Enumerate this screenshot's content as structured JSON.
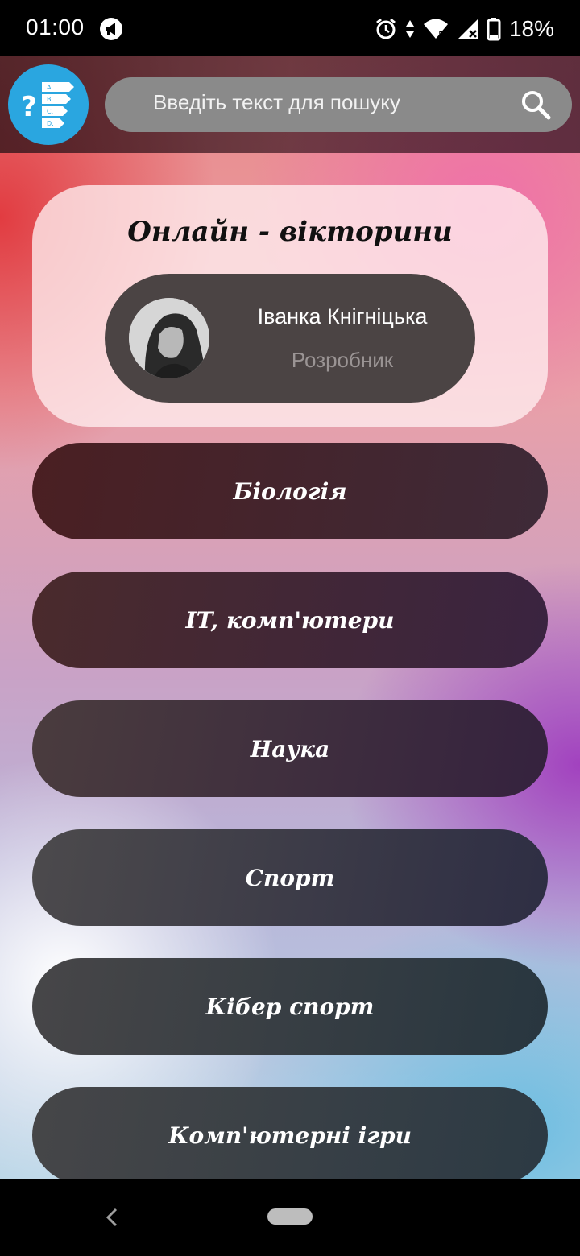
{
  "status_bar": {
    "time": "01:00",
    "battery_percent": "18%"
  },
  "header": {
    "search": {
      "placeholder": "Введіть текст для пошуку",
      "value": ""
    }
  },
  "profile_card": {
    "title": "Онлайн - вікторини",
    "name": "Іванка Кнігніцька",
    "role": "Розробник"
  },
  "categories": [
    {
      "label": "Біологія"
    },
    {
      "label": "IT, комп'ютери"
    },
    {
      "label": "Наука"
    },
    {
      "label": "Спорт"
    },
    {
      "label": "Кібер спорт"
    },
    {
      "label": "Комп'ютерні ігри"
    }
  ],
  "icons": {
    "logo": "quiz-logo-icon",
    "search": "search-icon",
    "alarm": "alarm-icon",
    "wifi": "wifi-icon",
    "signal": "signal-icon",
    "battery": "battery-icon",
    "notification": "megaphone-icon",
    "nav_back": "back-icon"
  },
  "colors": {
    "logo_bg": "#2aa6e0",
    "search_bg": "#8a8a8a",
    "profile_bg": "#4b4444"
  }
}
